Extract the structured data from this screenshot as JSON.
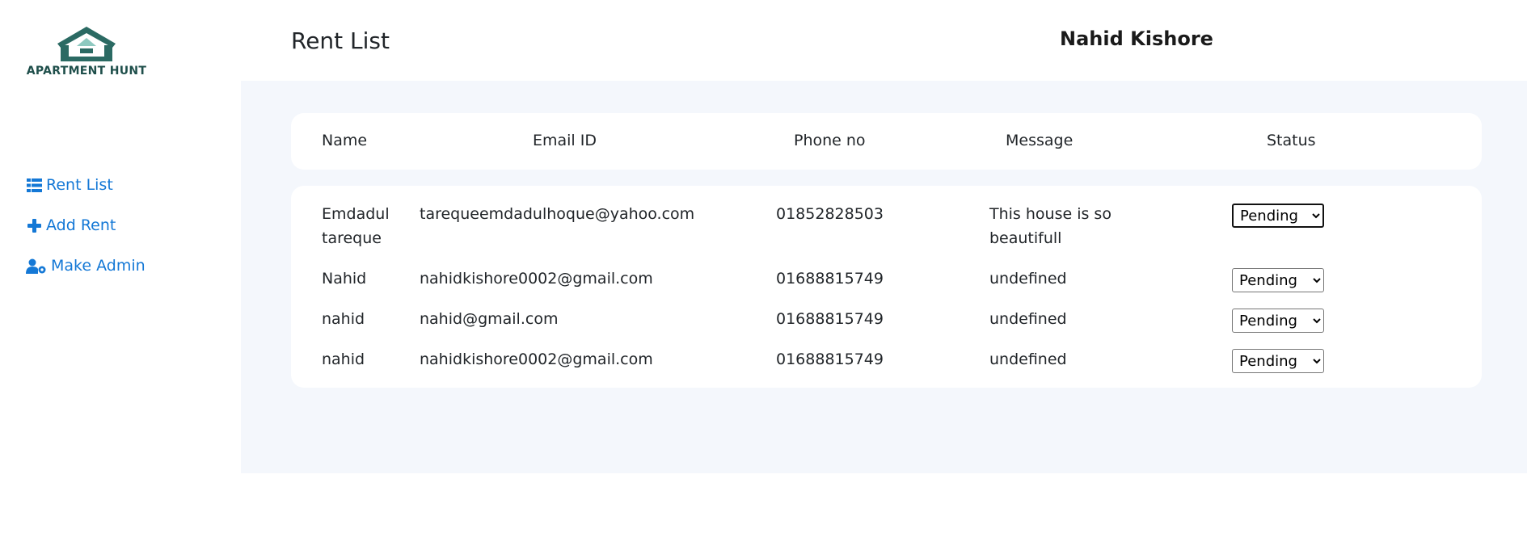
{
  "brand": {
    "name": "APARTMENT HUNT",
    "color": "#2b6a63",
    "roof_accent": "#8ec9c0"
  },
  "sidebar": {
    "items": [
      {
        "label": "Rent List",
        "icon": "list-icon"
      },
      {
        "label": "Add Rent",
        "icon": "plus-icon"
      },
      {
        "label": "Make Admin",
        "icon": "user-gear-icon"
      }
    ],
    "link_color": "#1478d6"
  },
  "header": {
    "title": "Rent List",
    "user_name": "Nahid Kishore"
  },
  "table": {
    "columns": [
      "Name",
      "Email ID",
      "Phone no",
      "Message",
      "Status"
    ],
    "rows": [
      {
        "name": "Emdadul tareque",
        "email": "tarequeemdadulhoque@yahoo.com",
        "phone": "01852828503",
        "message": "This house is so beautifull",
        "status": "Pending"
      },
      {
        "name": "Nahid",
        "email": "nahidkishore0002@gmail.com",
        "phone": "01688815749",
        "message": "undefined",
        "status": "Pending"
      },
      {
        "name": "nahid",
        "email": "nahid@gmail.com",
        "phone": "01688815749",
        "message": "undefined",
        "status": "Pending"
      },
      {
        "name": "nahid",
        "email": "nahidkishore0002@gmail.com",
        "phone": "01688815749",
        "message": "undefined",
        "status": "Pending"
      }
    ],
    "status_options": [
      "Pending"
    ]
  },
  "colors": {
    "background_panel": "#f4f7fc",
    "card": "#ffffff"
  }
}
